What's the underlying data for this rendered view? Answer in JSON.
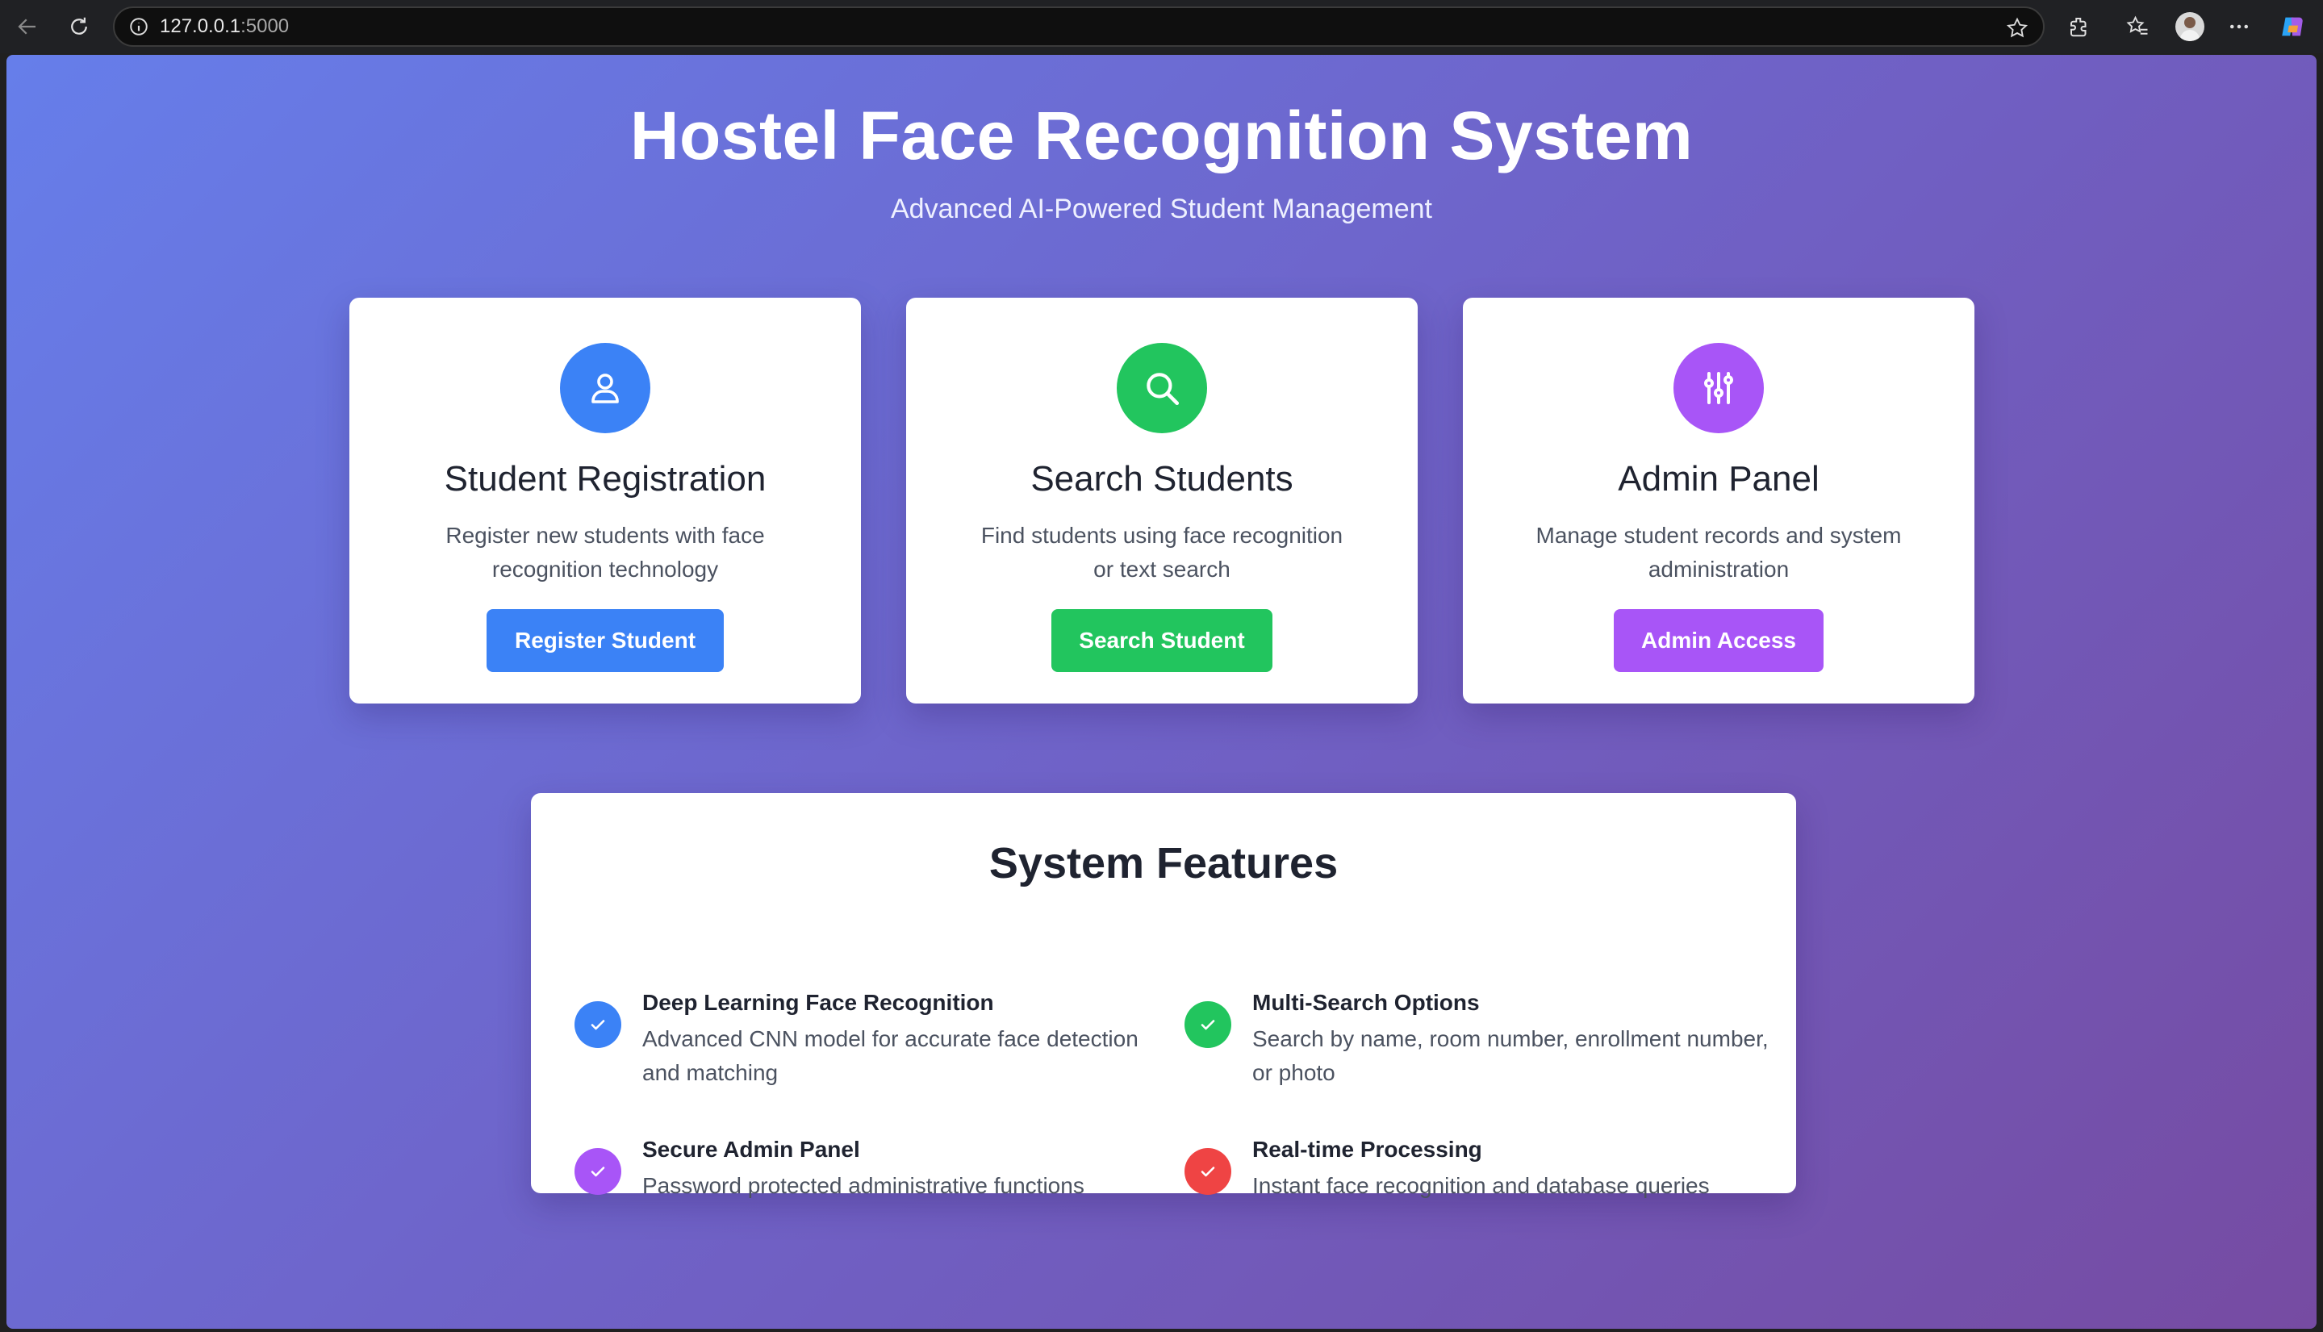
{
  "browser": {
    "url_host": "127.0.0.1",
    "url_port": ":5000"
  },
  "header": {
    "title": "Hostel Face Recognition System",
    "subtitle": "Advanced AI-Powered Student Management"
  },
  "cards": [
    {
      "title": "Student Registration",
      "description": "Register new students with face recognition technology",
      "button": "Register Student",
      "icon": "user-icon",
      "color": "#3b82f6"
    },
    {
      "title": "Search Students",
      "description": "Find students using face recognition or text search",
      "button": "Search Student",
      "icon": "search-icon",
      "color": "#22c55e"
    },
    {
      "title": "Admin Panel",
      "description": "Manage student records and system administration",
      "button": "Admin Access",
      "icon": "sliders-icon",
      "color": "#a855f7"
    }
  ],
  "features": {
    "title": "System Features",
    "items": [
      {
        "name": "Deep Learning Face Recognition",
        "description": "Advanced CNN model for accurate face detection and matching",
        "color": "#3b82f6"
      },
      {
        "name": "Multi-Search Options",
        "description": "Search by name, room number, enrollment number, or photo",
        "color": "#22c55e"
      },
      {
        "name": "Secure Admin Panel",
        "description": "Password protected administrative functions",
        "color": "#a855f7"
      },
      {
        "name": "Real-time Processing",
        "description": "Instant face recognition and database queries",
        "color": "#ef4444"
      }
    ]
  }
}
